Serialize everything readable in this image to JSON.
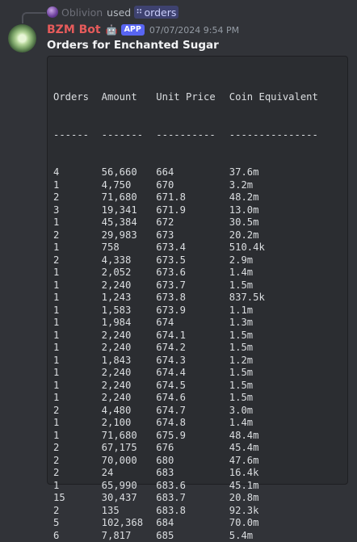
{
  "reply": {
    "user": "Oblivion",
    "used_text": "used",
    "command_icon": "slash-command-icon",
    "command": "orders"
  },
  "message": {
    "bot_name": "BZM Bot",
    "bot_icon": "robot-icon",
    "badge": "APP",
    "timestamp": "07/07/2024 9:54 PM",
    "title": "Orders for Enchanted Sugar"
  },
  "colors": {
    "background": "#313338",
    "bot_name": "#e65b5b",
    "badge": "#5865f2",
    "codeblock_bg": "#2b2d31"
  },
  "table": {
    "headers": [
      "Orders",
      "Amount",
      "Unit Price",
      "Coin Equivalent"
    ],
    "separators": [
      "------",
      "-------",
      "----------",
      "---------------"
    ],
    "rows": [
      [
        "4",
        "56,660",
        "664",
        "37.6m"
      ],
      [
        "1",
        "4,750",
        "670",
        "3.2m"
      ],
      [
        "2",
        "71,680",
        "671.8",
        "48.2m"
      ],
      [
        "3",
        "19,341",
        "671.9",
        "13.0m"
      ],
      [
        "1",
        "45,384",
        "672",
        "30.5m"
      ],
      [
        "2",
        "29,983",
        "673",
        "20.2m"
      ],
      [
        "1",
        "758",
        "673.4",
        "510.4k"
      ],
      [
        "2",
        "4,338",
        "673.5",
        "2.9m"
      ],
      [
        "1",
        "2,052",
        "673.6",
        "1.4m"
      ],
      [
        "1",
        "2,240",
        "673.7",
        "1.5m"
      ],
      [
        "1",
        "1,243",
        "673.8",
        "837.5k"
      ],
      [
        "1",
        "1,583",
        "673.9",
        "1.1m"
      ],
      [
        "1",
        "1,984",
        "674",
        "1.3m"
      ],
      [
        "1",
        "2,240",
        "674.1",
        "1.5m"
      ],
      [
        "1",
        "2,240",
        "674.2",
        "1.5m"
      ],
      [
        "1",
        "1,843",
        "674.3",
        "1.2m"
      ],
      [
        "1",
        "2,240",
        "674.4",
        "1.5m"
      ],
      [
        "1",
        "2,240",
        "674.5",
        "1.5m"
      ],
      [
        "1",
        "2,240",
        "674.6",
        "1.5m"
      ],
      [
        "2",
        "4,480",
        "674.7",
        "3.0m"
      ],
      [
        "1",
        "2,100",
        "674.8",
        "1.4m"
      ],
      [
        "1",
        "71,680",
        "675.9",
        "48.4m"
      ],
      [
        "2",
        "67,175",
        "676",
        "45.4m"
      ],
      [
        "2",
        "70,000",
        "680",
        "47.6m"
      ],
      [
        "2",
        "24",
        "683",
        "16.4k"
      ],
      [
        "1",
        "65,990",
        "683.6",
        "45.1m"
      ],
      [
        "15",
        "30,437",
        "683.7",
        "20.8m"
      ],
      [
        "2",
        "135",
        "683.8",
        "92.3k"
      ],
      [
        "5",
        "102,368",
        "684",
        "70.0m"
      ],
      [
        "6",
        "7,817",
        "685",
        "5.4m"
      ]
    ]
  }
}
